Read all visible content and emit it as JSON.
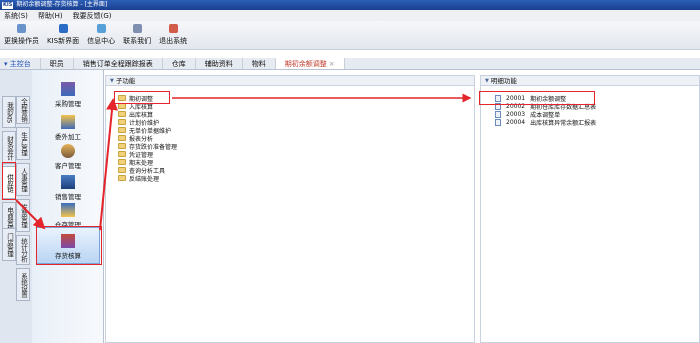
{
  "window": {
    "logo": "KIS",
    "title": "期初余额调整-存货核算 - [主界面]"
  },
  "menu": [
    "系统(S)",
    "帮助(H)",
    "我要反馈(G)"
  ],
  "toolbar": [
    "更换操作员",
    "KIS新界面",
    "信息中心",
    "联系我们",
    "退出系统"
  ],
  "tabs": {
    "home": "主控台",
    "items": [
      "职员",
      "销售订单全程跟踪报表",
      "仓库",
      "辅助资料",
      "物料"
    ],
    "active": "期初余额调整"
  },
  "side_tabs": [
    "我的KIS",
    "财务会计",
    "全程营销",
    "生产管理",
    "供应链",
    "人事管理",
    "电商管理",
    "发票管理",
    "门店管理",
    "统计分析",
    "系统设置"
  ],
  "modules": [
    "采购管理",
    "委外加工",
    "客户管理",
    "销售管理",
    "仓存管理",
    "存货核算"
  ],
  "sub_panel": {
    "title": "子功能",
    "items": [
      "期初调整",
      "入库核算",
      "出库核算",
      "计划价维护",
      "无单价单据维护",
      "报表分析",
      "存货跌价准备管理",
      "凭证管理",
      "期末处理",
      "查询分析工具",
      "反结账处理"
    ]
  },
  "detail_panel": {
    "title": "明细功能",
    "items": [
      {
        "code": "20001",
        "name": "期初余额调整"
      },
      {
        "code": "20002",
        "name": "期初仓库库存数据汇总表"
      },
      {
        "code": "20003",
        "name": "成本调整单"
      },
      {
        "code": "20004",
        "name": "出库核算异常余额汇报表"
      }
    ]
  },
  "colors": {
    "title_bg": "#1a3f8f",
    "highlight": "#e4252b",
    "active_tab": "#c0392b"
  }
}
